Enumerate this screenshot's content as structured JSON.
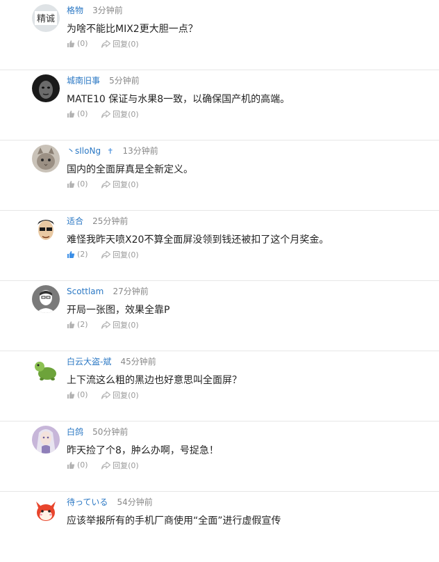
{
  "comments": [
    {
      "username": "格物",
      "time": "3分钟前",
      "badge": "",
      "text": "为啥不能比MIX2更大胆一点？",
      "likes": "(0)",
      "reply_label": "回复",
      "replies": "(0)",
      "liked": false,
      "avatar": "avatar-logo-icon"
    },
    {
      "username": "城南旧事",
      "time": "5分钟前",
      "badge": "",
      "text": "MATE10 保证与水果8一致，以确保国产机的高端。",
      "likes": "(0)",
      "reply_label": "回复",
      "replies": "(0)",
      "liked": false,
      "avatar": "avatar-dark-face-icon"
    },
    {
      "username": "丶sIloNg",
      "time": "13分钟前",
      "badge": "✝",
      "text": "国内的全面屏真是全新定义。",
      "likes": "(0)",
      "reply_label": "回复",
      "replies": "(0)",
      "liked": false,
      "avatar": "avatar-cat-icon"
    },
    {
      "username": "适合",
      "time": "25分钟前",
      "badge": "",
      "text": "难怪我昨天喷X20不算全面屏没领到钱还被扣了这个月奖金。",
      "likes": "(2)",
      "reply_label": "回复",
      "replies": "(0)",
      "liked": true,
      "avatar": "avatar-cartoon-glasses-icon"
    },
    {
      "username": "Scottlam",
      "time": "27分钟前",
      "badge": "",
      "text": "开局一张图，效果全靠P",
      "likes": "(2)",
      "reply_label": "回复",
      "replies": "(0)",
      "liked": false,
      "avatar": "avatar-default-icon"
    },
    {
      "username": "白云大盗-斌",
      "time": "45分钟前",
      "badge": "",
      "text": "上下流这么粗的黑边也好意思叫全面屏？",
      "likes": "(0)",
      "reply_label": "回复",
      "replies": "(0)",
      "liked": false,
      "avatar": "avatar-green-turtle-icon"
    },
    {
      "username": "白鸽",
      "time": "50分钟前",
      "badge": "",
      "text": "昨天捡了个8，肿么办啊，号捉急！",
      "likes": "(0)",
      "reply_label": "回复",
      "replies": "(0)",
      "liked": false,
      "avatar": "avatar-anime-icon"
    },
    {
      "username": "待っている",
      "time": "54分钟前",
      "badge": "",
      "text": "应该举报所有的手机厂商使用“全面”进行虚假宣传",
      "likes": "",
      "reply_label": "",
      "replies": "",
      "liked": false,
      "avatar": "avatar-red-fox-icon"
    }
  ],
  "colors": {
    "username": "#2b78c4",
    "muted": "#999999",
    "like_active": "#3b8ee6",
    "divider": "#e6e6e6"
  }
}
